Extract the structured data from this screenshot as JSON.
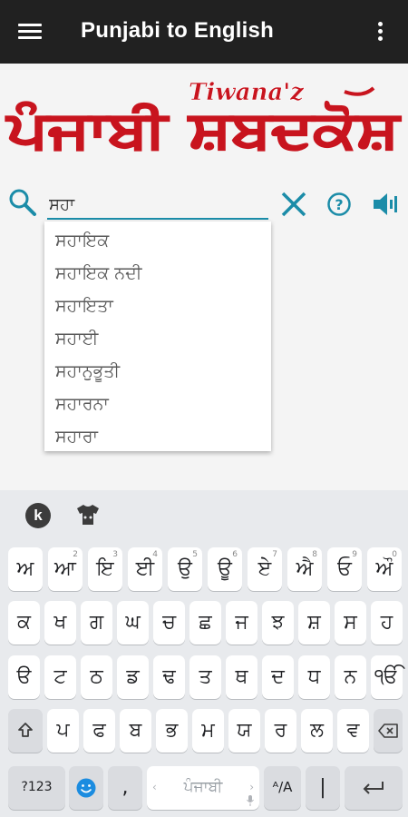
{
  "appbar": {
    "title": "Punjabi to English",
    "menu_icon": "hamburger-menu-icon",
    "overflow_icon": "more-vert-icon"
  },
  "logo": {
    "main_text": "ਪੰਜਾਬੀ ਸ਼ਬਦਕੋਸ਼",
    "brand_text": "Tiwana'z",
    "color": "#c8141e"
  },
  "search": {
    "value": "ਸਹਾ",
    "underline_color": "#1b8ca8",
    "icons": [
      "search-icon",
      "clear-icon",
      "help-icon",
      "speaker-icon"
    ]
  },
  "suggestions": [
    "ਸਹਾਇਕ",
    "ਸਹਾਇਕ ਨਦੀ",
    "ਸਹਾਇਤਾ",
    "ਸਹਾਈ",
    "ਸਹਾਨੁਭੂਤੀ",
    "ਸਹਾਰਨਾ",
    "ਸਹਾਰਾ"
  ],
  "keyboard": {
    "top_logo": "k",
    "row1": [
      {
        "k": "ਅ",
        "h": ""
      },
      {
        "k": "ਆ",
        "h": "2"
      },
      {
        "k": "ਇ",
        "h": "3"
      },
      {
        "k": "ਈ",
        "h": "4"
      },
      {
        "k": "ਉ",
        "h": "5"
      },
      {
        "k": "ਊ",
        "h": "6"
      },
      {
        "k": "ਏ",
        "h": "7"
      },
      {
        "k": "ਐ",
        "h": "8"
      },
      {
        "k": "ਓ",
        "h": "9"
      },
      {
        "k": "ਔ",
        "h": "0"
      }
    ],
    "row2": [
      "ਕ",
      "ਖ",
      "ਗ",
      "ਘ",
      "ਚ",
      "ਛ",
      "ਜ",
      "ਝ",
      "ਸ਼",
      "ਸ",
      "ਹ"
    ],
    "row3": [
      "ੳ",
      "ਟ",
      "ਠ",
      "ਡ",
      "ਢ",
      "ਤ",
      "ਥ",
      "ਦ",
      "ਧ",
      "ਨ",
      "ੴ"
    ],
    "row4": [
      "ਪ",
      "ਫ",
      "ਬ",
      "ਭ",
      "ਮ",
      "ਯ",
      "ਰ",
      "ਲ",
      "ਵ"
    ],
    "num_label": "?123",
    "comma": ",",
    "space_label": "ਪੰਜਾਬੀ",
    "lang_switch": "ᴬ/A",
    "pipe": "|"
  }
}
